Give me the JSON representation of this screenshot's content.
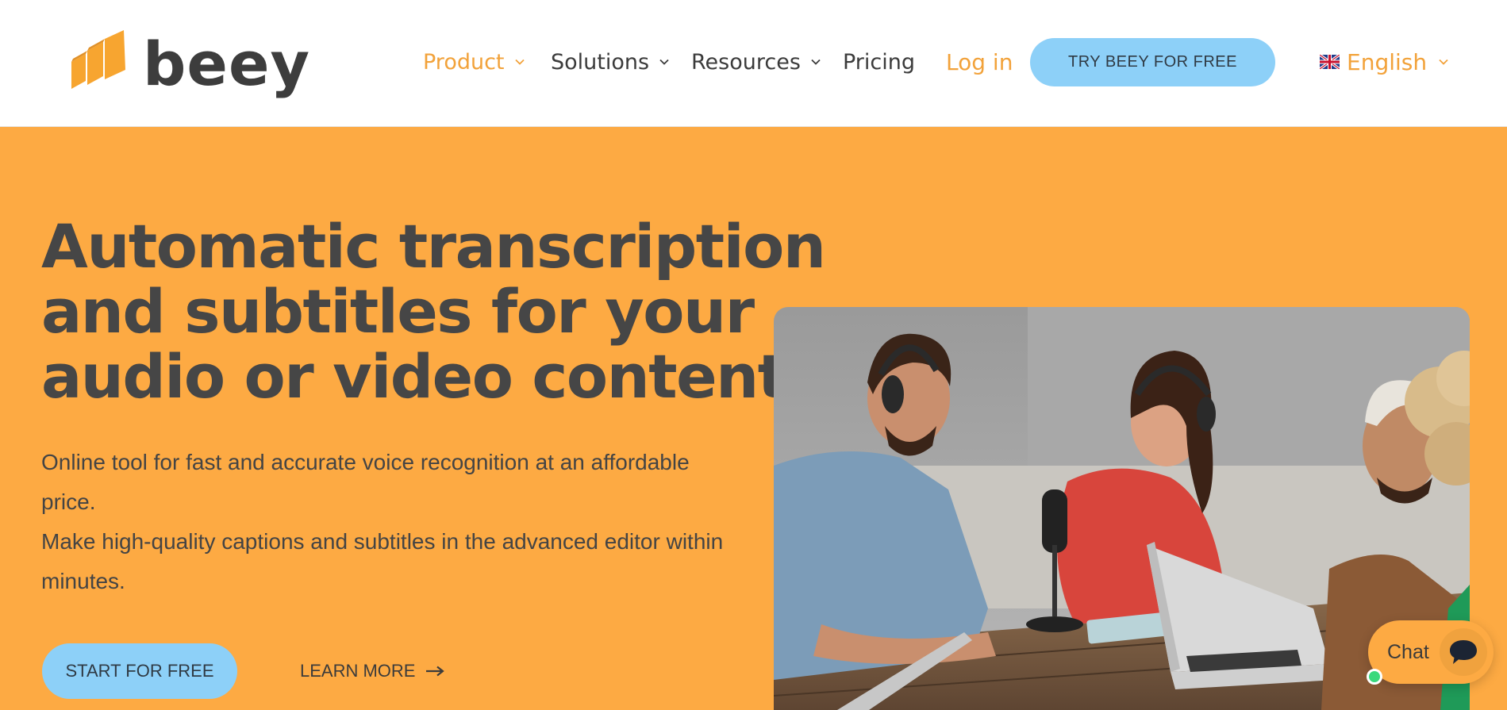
{
  "brand": {
    "name": "beey",
    "accent_color": "#fdaa43",
    "link_color": "#f2a23a",
    "button_color": "#8dd0f8"
  },
  "nav": {
    "items": [
      {
        "label": "Product",
        "has_dropdown": true,
        "active": true
      },
      {
        "label": "Solutions",
        "has_dropdown": true
      },
      {
        "label": "Resources",
        "has_dropdown": true
      },
      {
        "label": "Pricing",
        "has_dropdown": false
      }
    ],
    "login_label": "Log in",
    "cta_label": "TRY BEEY FOR FREE",
    "language": {
      "label": "English",
      "flag_icon": "uk-flag-icon"
    }
  },
  "hero": {
    "title_lines": [
      "Automatic transcription",
      "and subtitles for your",
      "audio or video content"
    ],
    "paragraphs": [
      "Online tool for fast and accurate voice recognition at an affordable price.",
      "Make high-quality captions and subtitles in the advanced editor within minutes."
    ],
    "primary_button": "START FOR FREE",
    "secondary_link": "LEARN MORE",
    "secondary_icon": "arrow-right-icon",
    "image_alt": "podcast-recording-photo"
  },
  "chat": {
    "label": "Chat",
    "icon": "chat-bubble-icon",
    "status_color": "#39d97c"
  }
}
